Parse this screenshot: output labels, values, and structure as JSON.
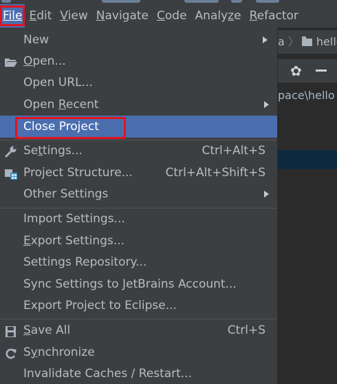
{
  "menubar": {
    "items": [
      {
        "label": "File",
        "underline": "F"
      },
      {
        "label": "Edit",
        "underline": "E"
      },
      {
        "label": "View",
        "underline": "V"
      },
      {
        "label": "Navigate",
        "underline": "N"
      },
      {
        "label": "Code",
        "underline": "C"
      },
      {
        "label": "Analyze",
        "underline": ""
      },
      {
        "label": "Refactor",
        "underline": "R"
      }
    ]
  },
  "background": {
    "breadcrumb_prefix": "a",
    "breadcrumb_folder": "hello",
    "path_text": "pace\\hello"
  },
  "file_menu": {
    "new": "New",
    "open": "Open...",
    "open_url": "Open URL...",
    "open_recent": "Open Recent",
    "close_project": "Close Project",
    "settings": "Settings...",
    "settings_shortcut": "Ctrl+Alt+S",
    "project_structure": "Project Structure...",
    "project_structure_shortcut": "Ctrl+Alt+Shift+S",
    "other_settings": "Other Settings",
    "import_settings": "Import Settings...",
    "export_settings": "Export Settings...",
    "settings_repository": "Settings Repository...",
    "sync_settings": "Sync Settings to JetBrains Account...",
    "export_eclipse": "Export Project to Eclipse...",
    "save_all": "Save All",
    "save_all_shortcut": "Ctrl+S",
    "synchronize": "Synchronize",
    "invalidate_caches": "Invalidate Caches / Restart..."
  },
  "colors": {
    "menu_bg": "#3c3f41",
    "highlight": "#4b6eaf",
    "annotation_red": "#e0141e"
  }
}
